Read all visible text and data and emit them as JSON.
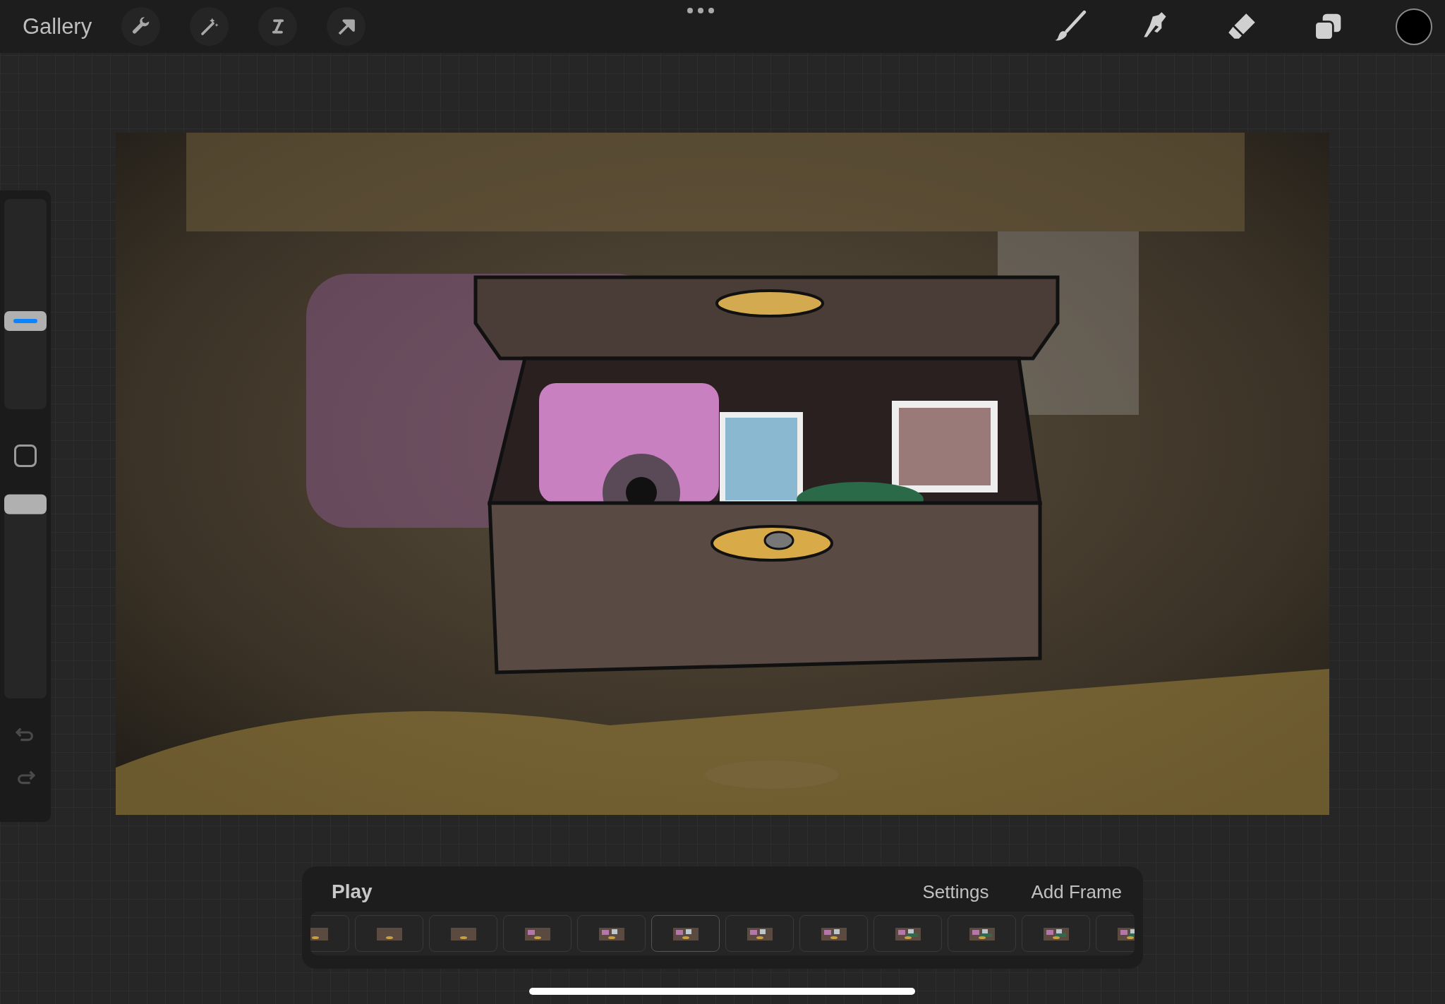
{
  "toolbar": {
    "gallery": "Gallery"
  },
  "sidebar": {
    "brush_size": {
      "level": 0.42
    },
    "opacity": {
      "level": 0.96
    }
  },
  "timeline": {
    "play": "Play",
    "settings": "Settings",
    "add_frame": "Add Frame",
    "frames": [
      {
        "selected": false
      },
      {
        "selected": false
      },
      {
        "selected": false
      },
      {
        "selected": false
      },
      {
        "selected": false
      },
      {
        "selected": true
      },
      {
        "selected": false
      },
      {
        "selected": false
      },
      {
        "selected": false
      },
      {
        "selected": false
      },
      {
        "selected": false
      },
      {
        "selected": false
      }
    ]
  }
}
